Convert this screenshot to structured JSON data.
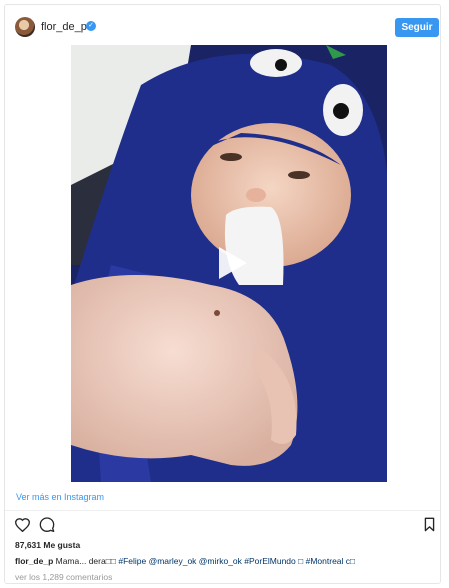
{
  "header": {
    "username": "flor_de_p",
    "verified_badge": "✓",
    "follow_label": "Seguir"
  },
  "media": {
    "play_icon": "play-icon"
  },
  "footer": {
    "view_link": "Ver más en Instagram",
    "likes": "87,631 Me gusta",
    "caption_user": "flor_de_p",
    "caption_text": " Mama... dera□□ ",
    "caption_tags": "#Felipe @marley_ok @mirko_ok #PorElMundo □ #Montreal c□",
    "comments": "ver los 1,289 comentarios"
  },
  "icons": {
    "like": "heart-icon",
    "comment": "comment-icon",
    "save": "bookmark-icon"
  },
  "colors": {
    "accent": "#3897f0",
    "text": "#262626",
    "muted": "#999999"
  }
}
